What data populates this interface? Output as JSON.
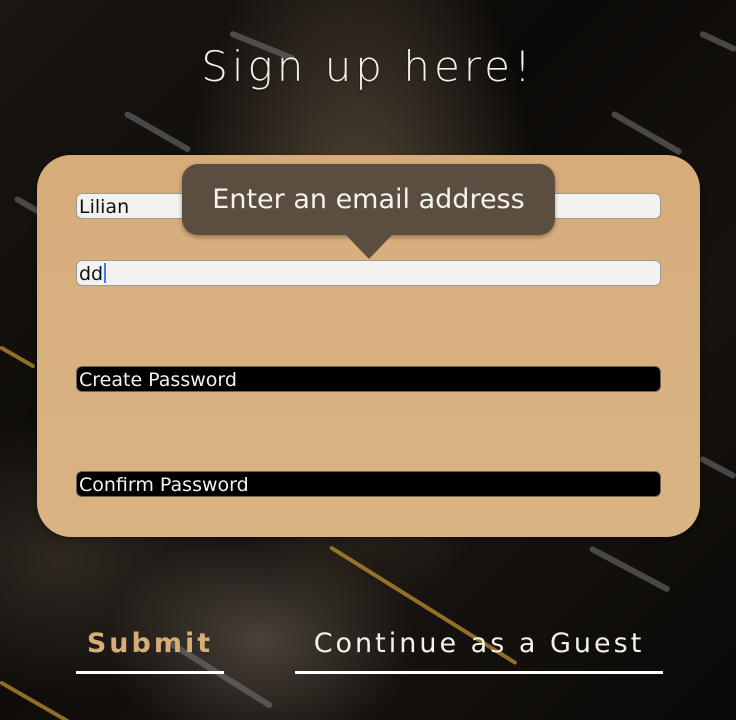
{
  "page": {
    "title": "Sign up here!"
  },
  "form": {
    "name_value": "Lilian",
    "email_value": "dd",
    "password_placeholder": "Create Password",
    "confirm_placeholder": "Confirm Password"
  },
  "tooltip": {
    "text": "Enter an email address"
  },
  "actions": {
    "submit_label": "Submit",
    "guest_label": "Continue as a Guest"
  },
  "colors": {
    "card": "#d6ac78",
    "tooltip": "#5b4e41",
    "submit_text": "#d7ad77",
    "caret": "#3b7cf0"
  }
}
